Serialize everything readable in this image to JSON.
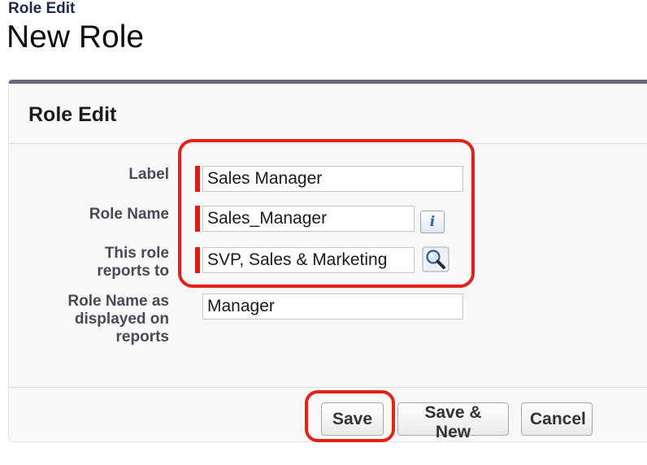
{
  "header": {
    "breadcrumb": "Role Edit",
    "title": "New Role"
  },
  "panel": {
    "heading": "Role Edit",
    "fields": [
      {
        "label": "Label",
        "value": "Sales Manager",
        "required": true
      },
      {
        "label": "Role Name",
        "value": "Sales_Manager",
        "required": true
      },
      {
        "label_line1": "This role",
        "label_line2": "reports to",
        "value": "SVP, Sales & Marketing",
        "required": true
      },
      {
        "label_line1": "Role Name as",
        "label_line2": "displayed on",
        "label_line3": "reports",
        "value": "Manager",
        "required": false
      }
    ]
  },
  "buttons": {
    "save": "Save",
    "save_new": "Save & New",
    "cancel": "Cancel"
  },
  "icons": {
    "info": "info-icon",
    "lookup": "lookup-magnifier-icon"
  },
  "colors": {
    "required": "#d0201c",
    "highlight": "#e2231a",
    "panel_border": "#646a7a"
  }
}
